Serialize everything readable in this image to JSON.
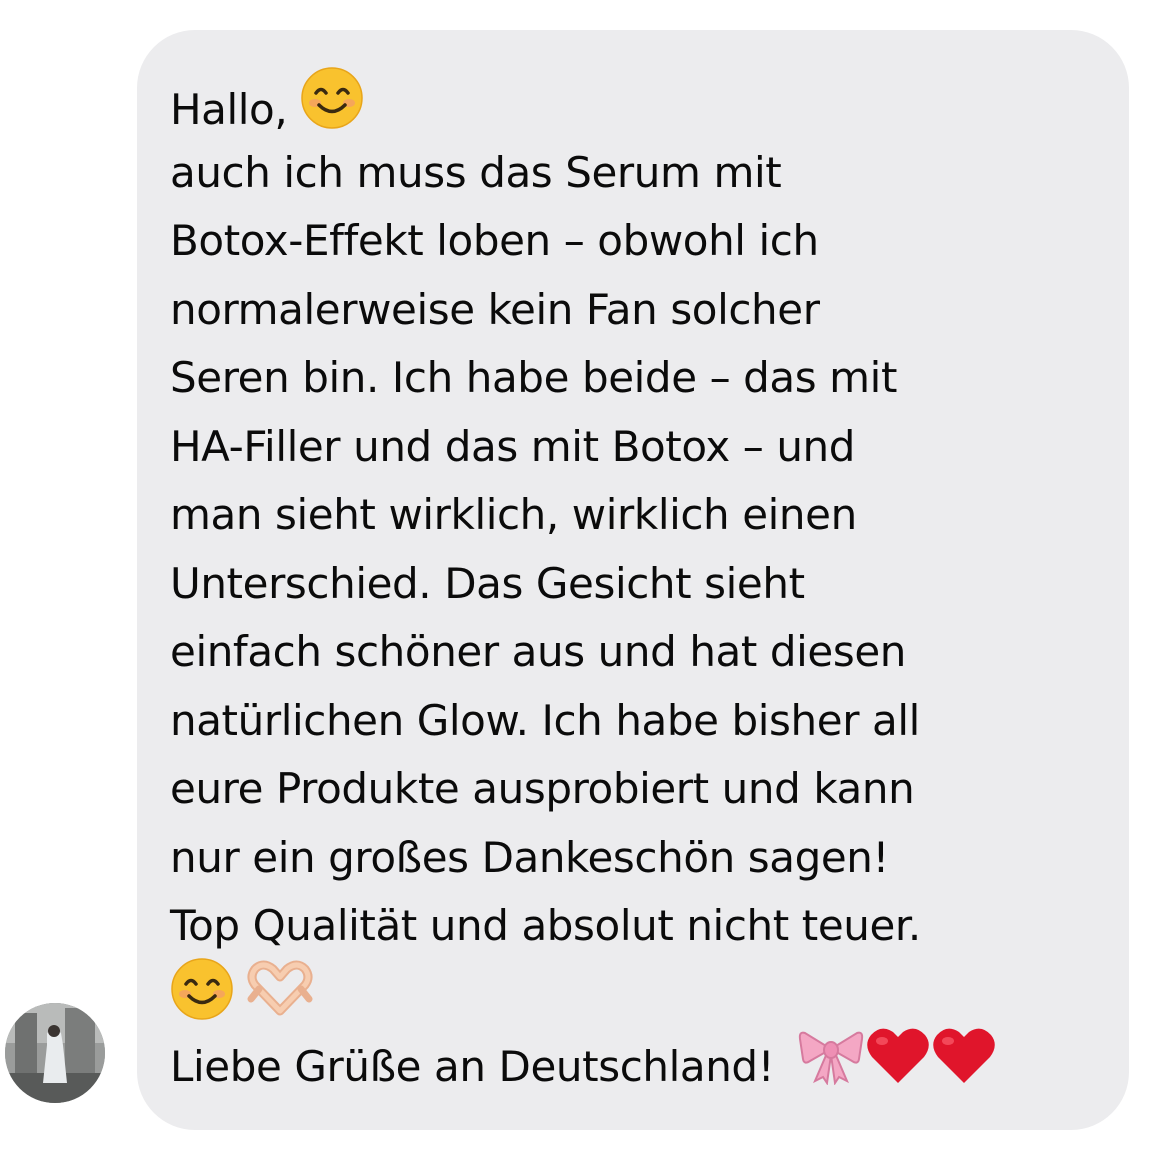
{
  "message": {
    "line_1": "Hallo,",
    "line_2": "auch ich muss das Serum mit",
    "line_3": "Botox-Effekt loben – obwohl ich",
    "line_4": "normalerweise kein Fan solcher",
    "line_5": "Seren bin. Ich habe beide – das mit",
    "line_6": "HA-Filler und das mit Botox – und",
    "line_7": "man sieht wirklich, wirklich einen",
    "line_8": "Unterschied. Das Gesicht sieht",
    "line_9": "einfach schöner aus und hat diesen",
    "line_10": "natürlichen Glow. Ich habe bisher all",
    "line_11": "eure Produkte ausprobiert und kann",
    "line_12": "nur ein großes Dankeschön sagen!",
    "line_13": "Top Qualität und absolut nicht teuer.",
    "line_15": "Liebe Grüße an Deutschland!"
  },
  "emojis": {
    "greeting": "smiling-face-icon",
    "closing": [
      "smiling-face-icon",
      "heart-hands-icon"
    ],
    "signoff": [
      "ribbon-icon",
      "red-heart-icon",
      "red-heart-icon"
    ]
  },
  "colors": {
    "bubble_background": "#ececee",
    "text": "#0b0b0b",
    "heart": "#e0152b",
    "ribbon": "#f4a7c4",
    "smiley": "#f9c22e"
  },
  "sender": {
    "avatar": "sender-avatar"
  }
}
